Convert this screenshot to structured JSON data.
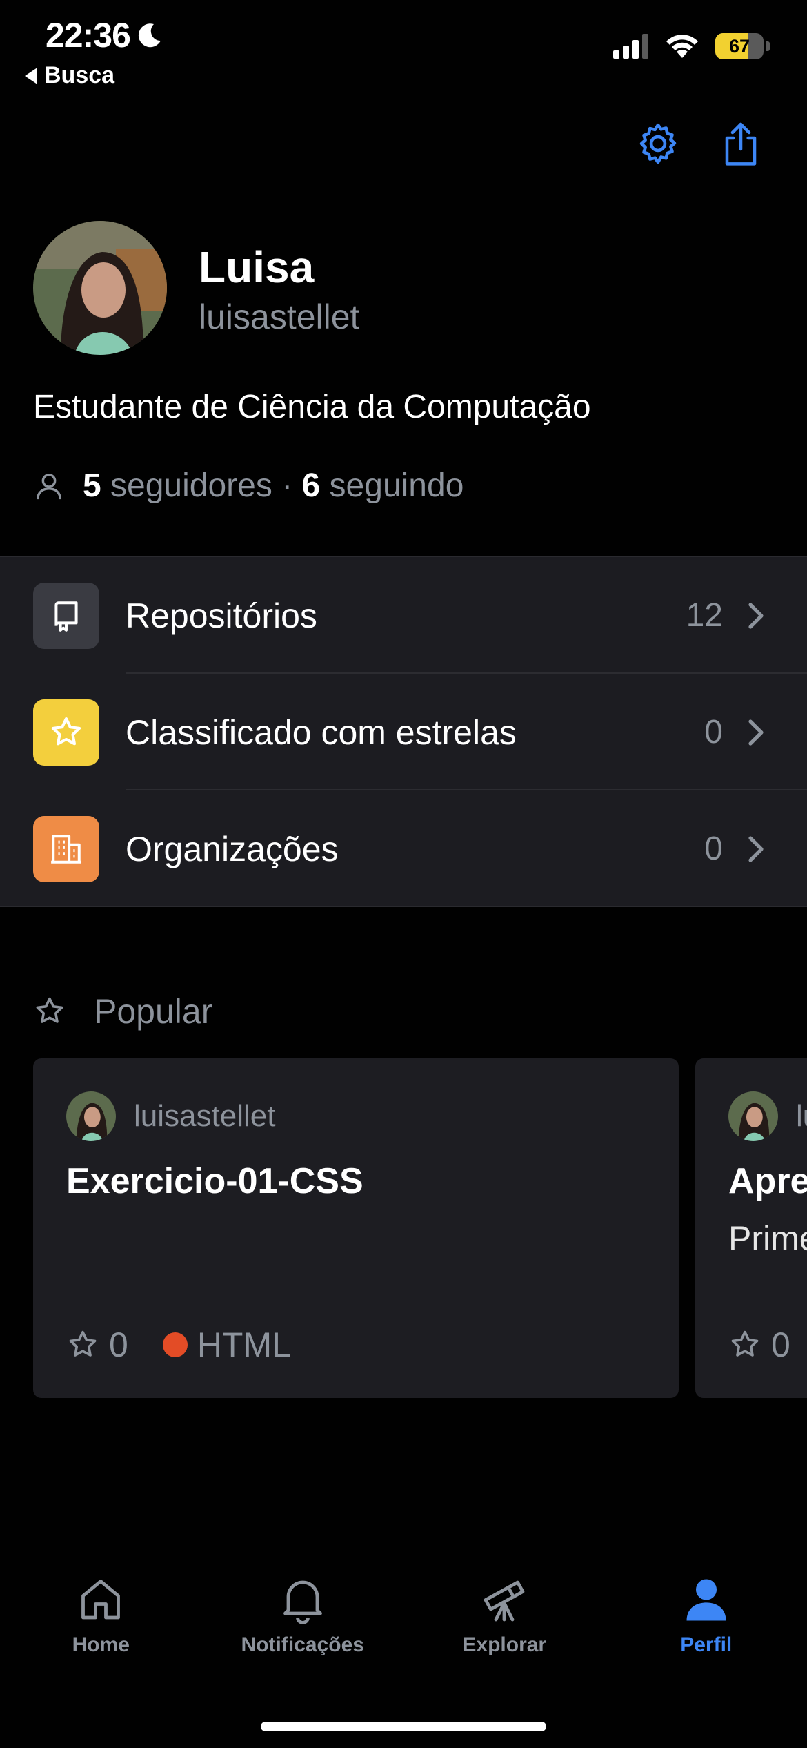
{
  "status_bar": {
    "time": "22:36",
    "back_label": "Busca",
    "battery_level": "67",
    "battery_fraction": 0.67
  },
  "header": {
    "settings_icon": "gear-icon",
    "share_icon": "share-icon"
  },
  "profile": {
    "name": "Luisa",
    "login": "luisastellet",
    "bio": "Estudante de Ciência da Computação",
    "followers_count": "5",
    "followers_label": " seguidores · ",
    "following_count": "6",
    "following_label": " seguindo"
  },
  "menu": [
    {
      "label": "Repositórios",
      "count": "12",
      "icon": "repo-icon",
      "color": "#3a3b42"
    },
    {
      "label": "Classificado com estrelas",
      "count": "0",
      "icon": "star-icon",
      "color": "#f3cf3d"
    },
    {
      "label": "Organizações",
      "count": "0",
      "icon": "organization-icon",
      "color": "#ef8c46"
    }
  ],
  "popular": {
    "title": "Popular",
    "cards": [
      {
        "owner": "luisastellet",
        "name": "Exercicio-01-CSS",
        "description": "",
        "stars": "0",
        "language": "HTML",
        "language_color": "#e34c26"
      },
      {
        "owner": "luisastellet",
        "name": "Apresentacao",
        "description": "Primeiro repositório",
        "stars": "0"
      }
    ]
  },
  "tabs": [
    {
      "label": "Home",
      "icon": "home-icon",
      "active": false
    },
    {
      "label": "Notificações",
      "icon": "bell-icon",
      "active": false
    },
    {
      "label": "Explorar",
      "icon": "telescope-icon",
      "active": false
    },
    {
      "label": "Perfil",
      "icon": "person-icon",
      "active": true
    }
  ],
  "colors": {
    "accent": "#3d86f5",
    "muted": "#8d939c",
    "background": "#010101",
    "surface": "#1c1c21"
  }
}
